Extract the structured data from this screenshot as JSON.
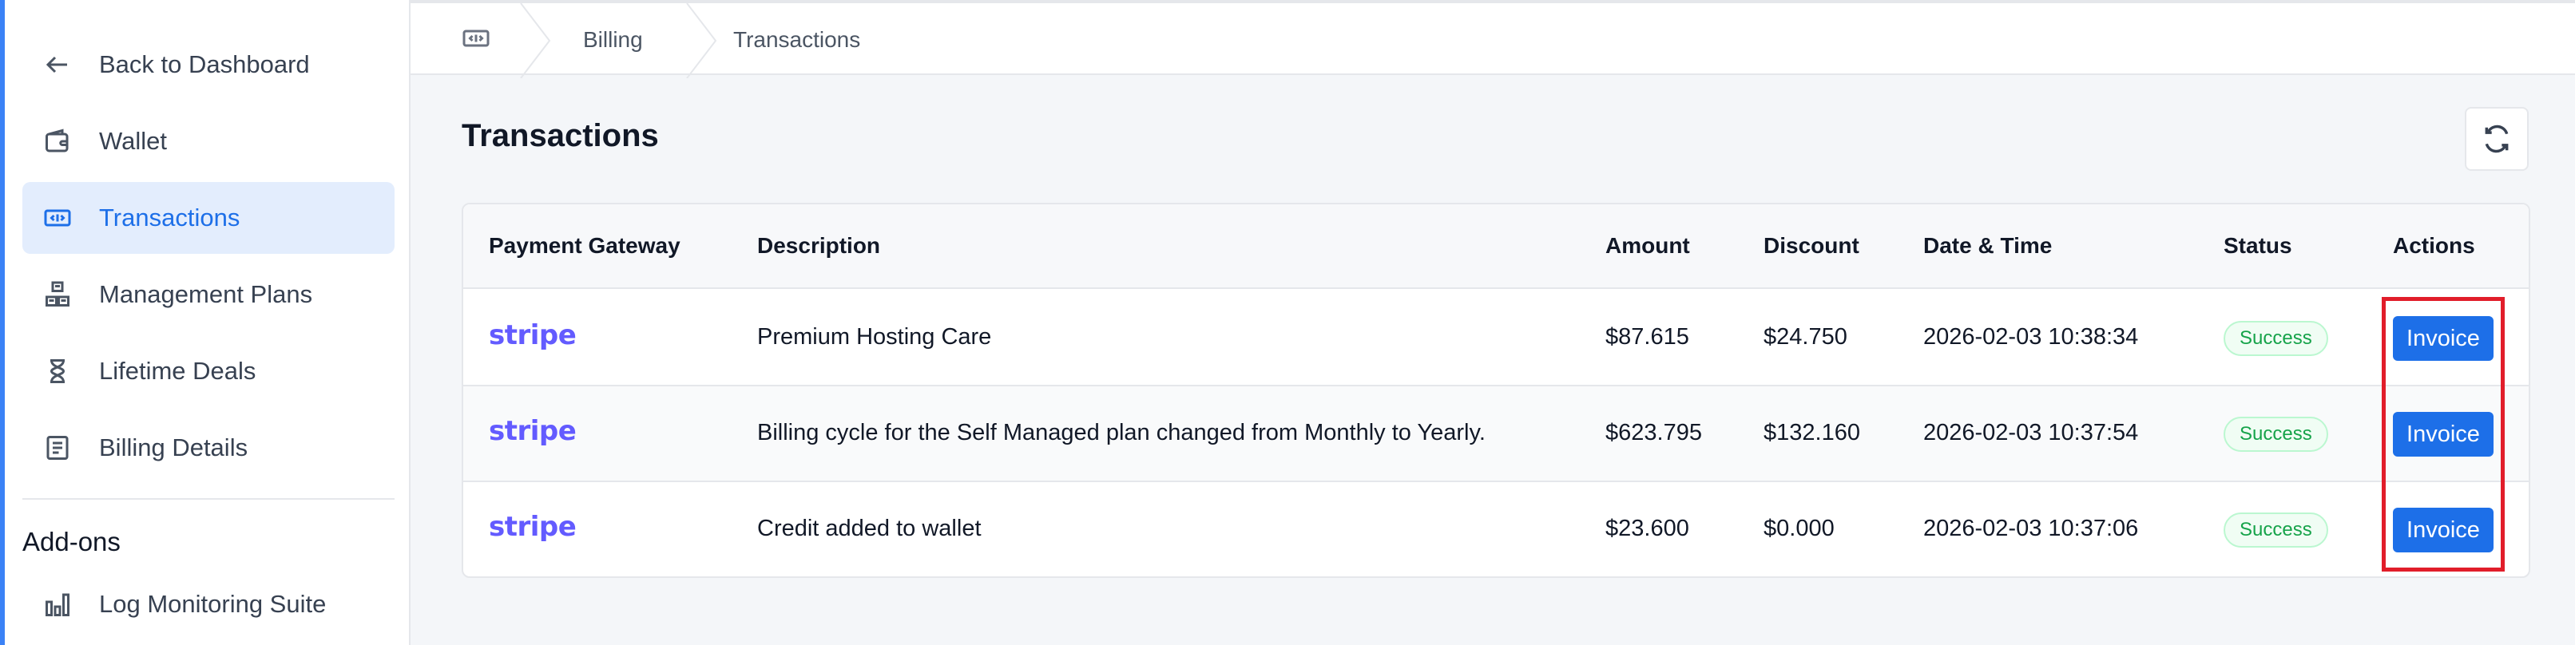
{
  "sidebar": {
    "items": [
      {
        "label": "Back to Dashboard",
        "icon": "arrow-left-icon"
      },
      {
        "label": "Wallet",
        "icon": "wallet-icon"
      },
      {
        "label": "Transactions",
        "icon": "ticket-icon",
        "active": true
      },
      {
        "label": "Management Plans",
        "icon": "boxes-icon"
      },
      {
        "label": "Lifetime Deals",
        "icon": "hourglass-icon"
      },
      {
        "label": "Billing Details",
        "icon": "document-icon"
      }
    ],
    "addons_title": "Add-ons",
    "addons": [
      {
        "label": "Log Monitoring Suite",
        "icon": "bar-chart-icon"
      }
    ]
  },
  "breadcrumb": {
    "items": [
      "Billing",
      "Transactions"
    ]
  },
  "main": {
    "title": "Transactions",
    "table": {
      "headers": [
        "Payment Gateway",
        "Description",
        "Amount",
        "Discount",
        "Date & Time",
        "Status",
        "Actions"
      ],
      "rows": [
        {
          "gateway": "stripe",
          "description": "Premium Hosting Care",
          "amount": "$87.615",
          "discount": "$24.750",
          "datetime": "2026-02-03 10:38:34",
          "status": "Success",
          "action": "Invoice"
        },
        {
          "gateway": "stripe",
          "description": "Billing cycle for the Self Managed plan changed from Monthly to Yearly.",
          "amount": "$623.795",
          "discount": "$132.160",
          "datetime": "2026-02-03 10:37:54",
          "status": "Success",
          "action": "Invoice"
        },
        {
          "gateway": "stripe",
          "description": "Credit added to wallet",
          "amount": "$23.600",
          "discount": "$0.000",
          "datetime": "2026-02-03 10:37:06",
          "status": "Success",
          "action": "Invoice"
        }
      ]
    }
  },
  "colors": {
    "accent": "#1d6fe8",
    "stripe": "#635bff",
    "success": "#16a34a",
    "highlight": "#e11d2a"
  }
}
